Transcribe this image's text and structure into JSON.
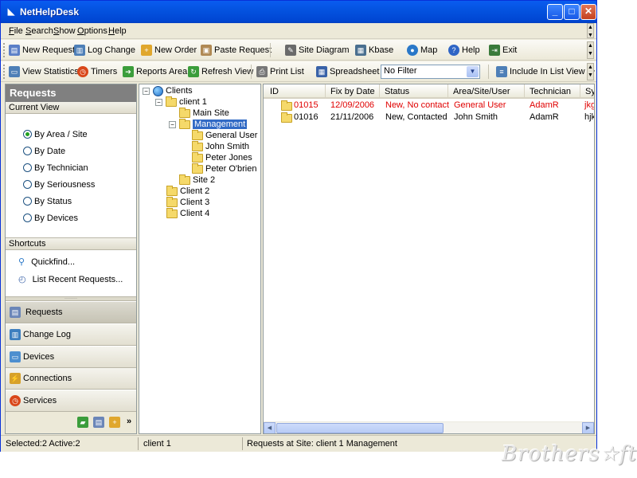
{
  "window": {
    "title": "NetHelpDesk",
    "min": "_",
    "max": "□",
    "close": "✕"
  },
  "menu": [
    {
      "u": "F",
      "rest": "ile"
    },
    {
      "u": "S",
      "rest": "earch"
    },
    {
      "u": "S",
      "rest": "how"
    },
    {
      "u": "O",
      "rest": "ptions"
    },
    {
      "u": "H",
      "rest": "elp"
    }
  ],
  "toolbar1": [
    {
      "label": "New Request",
      "icon": "new-request-icon",
      "color": "#5b7fc7"
    },
    {
      "label": "Log Change",
      "icon": "log-change-icon",
      "color": "#4e7fb7"
    },
    {
      "label": "New Order",
      "icon": "new-order-icon",
      "color": "#e0a72d"
    },
    {
      "label": "Paste Request",
      "icon": "paste-icon",
      "color": "#b08954"
    },
    {
      "label": "Site Diagram",
      "icon": "pencil-icon",
      "color": "#6a6a6a"
    },
    {
      "label": "Kbase",
      "icon": "book-icon",
      "color": "#4a6f8f"
    },
    {
      "label": "Map",
      "icon": "magnifier-icon",
      "color": "#2a78c8"
    },
    {
      "label": "Help",
      "icon": "help-icon",
      "color": "#2f65c5"
    },
    {
      "label": "Exit",
      "icon": "exit-icon",
      "color": "#3a7a3a"
    }
  ],
  "toolbar2": [
    {
      "label": "View Statistics",
      "icon": "statistics-icon",
      "color": "#4e7fb7"
    },
    {
      "label": "Timers",
      "icon": "timer-icon",
      "color": "#d9471a"
    },
    {
      "label": "Reports Area",
      "icon": "reports-icon",
      "color": "#3b9d3b"
    },
    {
      "label": "Refresh View",
      "icon": "refresh-icon",
      "color": "#3b9d3b"
    },
    {
      "label": "Print List",
      "icon": "printer-icon",
      "color": "#777777"
    },
    {
      "label": "Spreadsheet",
      "icon": "spreadsheet-icon",
      "color": "#3962a8"
    },
    {
      "label": "Include In List View",
      "icon": "list-view-icon",
      "color": "#4e7fb7"
    }
  ],
  "filter": {
    "value": "No Filter"
  },
  "left_panel": {
    "header": "Requests",
    "current_view": "Current View",
    "views": [
      {
        "label": "By Area / Site",
        "selected": true
      },
      {
        "label": "By Date",
        "selected": false
      },
      {
        "label": "By Technician",
        "selected": false
      },
      {
        "label": "By Seriousness",
        "selected": false
      },
      {
        "label": "By Status",
        "selected": false
      },
      {
        "label": "By Devices",
        "selected": false
      }
    ],
    "shortcuts_title": "Shortcuts",
    "shortcuts": [
      {
        "label": "Quickfind...",
        "icon": "quickfind-icon"
      },
      {
        "label": "List Recent Requests...",
        "icon": "recent-requests-icon"
      }
    ],
    "nav": [
      {
        "label": "Requests",
        "icon": "requests-icon",
        "color": "#6b86b8",
        "active": true
      },
      {
        "label": "Change Log",
        "icon": "change-log-icon",
        "color": "#3e7fbf",
        "active": false
      },
      {
        "label": "Devices",
        "icon": "devices-icon",
        "color": "#4e8fcf",
        "active": false
      },
      {
        "label": "Connections",
        "icon": "connections-icon",
        "color": "#d7a12a",
        "active": false
      },
      {
        "label": "Services",
        "icon": "services-icon",
        "color": "#d9471a",
        "active": false
      }
    ]
  },
  "tree": {
    "root": "Clients",
    "client1": "client 1",
    "main_site": "Main Site",
    "management": "Management",
    "users": [
      "General User",
      "John Smith",
      "Peter Jones",
      "Peter O'brien"
    ],
    "site2": "Site 2",
    "clients": [
      "Client 2",
      "Client 3",
      "Client 4"
    ]
  },
  "list": {
    "columns": [
      "ID",
      "Fix by Date",
      "Status",
      "Area/Site/User",
      "Technician",
      "Sy"
    ],
    "rows": [
      {
        "id": "01015",
        "date": "12/09/2006",
        "status": "New, No contact",
        "area": "General User",
        "tech": "AdamR",
        "sy": "jkg",
        "highlight": true
      },
      {
        "id": "01016",
        "date": "21/11/2006",
        "status": "New, Contacted",
        "area": "John Smith",
        "tech": "AdamR",
        "sy": "hjk",
        "highlight": false
      }
    ]
  },
  "status": {
    "selected": "Selected:2  Active:2",
    "context": "client 1",
    "site": "Requests at Site:  client 1  Management"
  },
  "watermark": "Brothers☆ft"
}
